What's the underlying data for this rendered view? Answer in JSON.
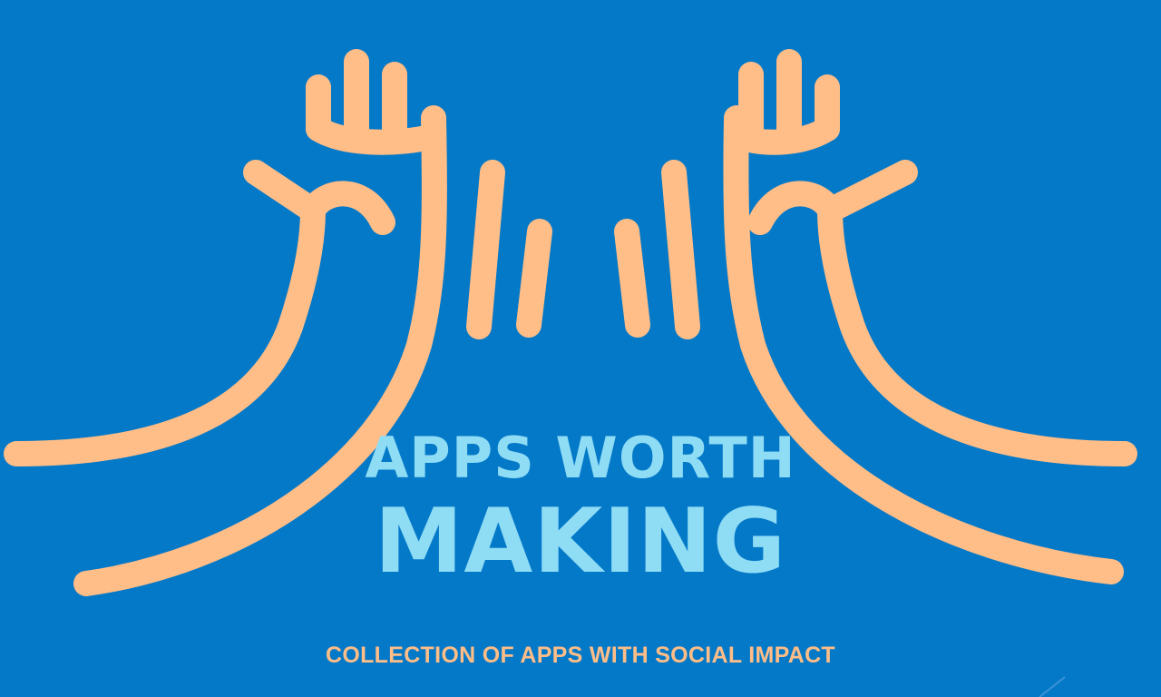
{
  "colors": {
    "background": "#0479c8",
    "hands": "#ffbd87",
    "title": "#8fdcf5",
    "tagline": "#ffbd87"
  },
  "graphic": {
    "icon": "high-five-hands-icon"
  },
  "title": {
    "line1": "APPS WORTH",
    "line2": "MAKING"
  },
  "tagline": "COLLECTION OF APPS WITH SOCIAL IMPACT"
}
